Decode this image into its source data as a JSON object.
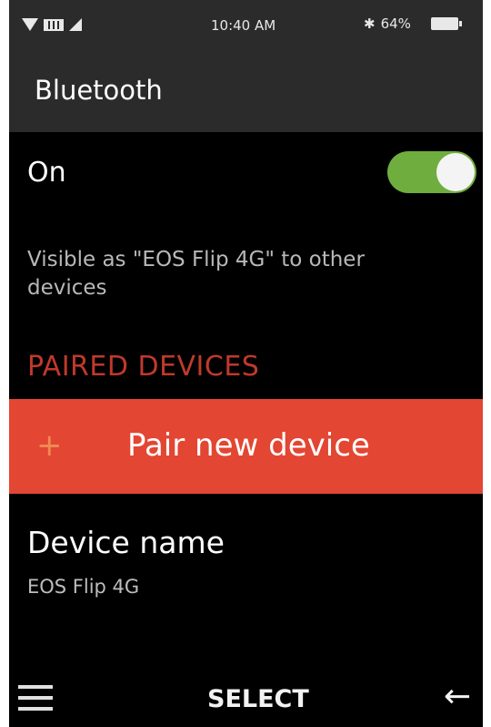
{
  "status_bar": {
    "time": "10:40 AM",
    "battery": "64%",
    "bluetooth_symbol": "✱",
    "icons": [
      "wifi-icon",
      "lte-icon",
      "signal-icon",
      "bluetooth-icon",
      "battery-icon"
    ]
  },
  "header": {
    "title": "Bluetooth"
  },
  "bluetooth_toggle": {
    "label": "On",
    "state": true,
    "color_on": "#6fae3e"
  },
  "visibility_text": "Visible as \"EOS Flip 4G\" to other devices",
  "paired_section": {
    "heading": "PAIRED DEVICES",
    "heading_color": "#c0392b"
  },
  "pair_new": {
    "icon": "+",
    "label": "Pair new device",
    "highlight_color": "#e34632"
  },
  "device_name": {
    "title": "Device name",
    "value": "EOS Flip 4G"
  },
  "softkeys": {
    "left_icon": "menu-icon",
    "center_label": "SELECT",
    "right_icon": "←"
  }
}
